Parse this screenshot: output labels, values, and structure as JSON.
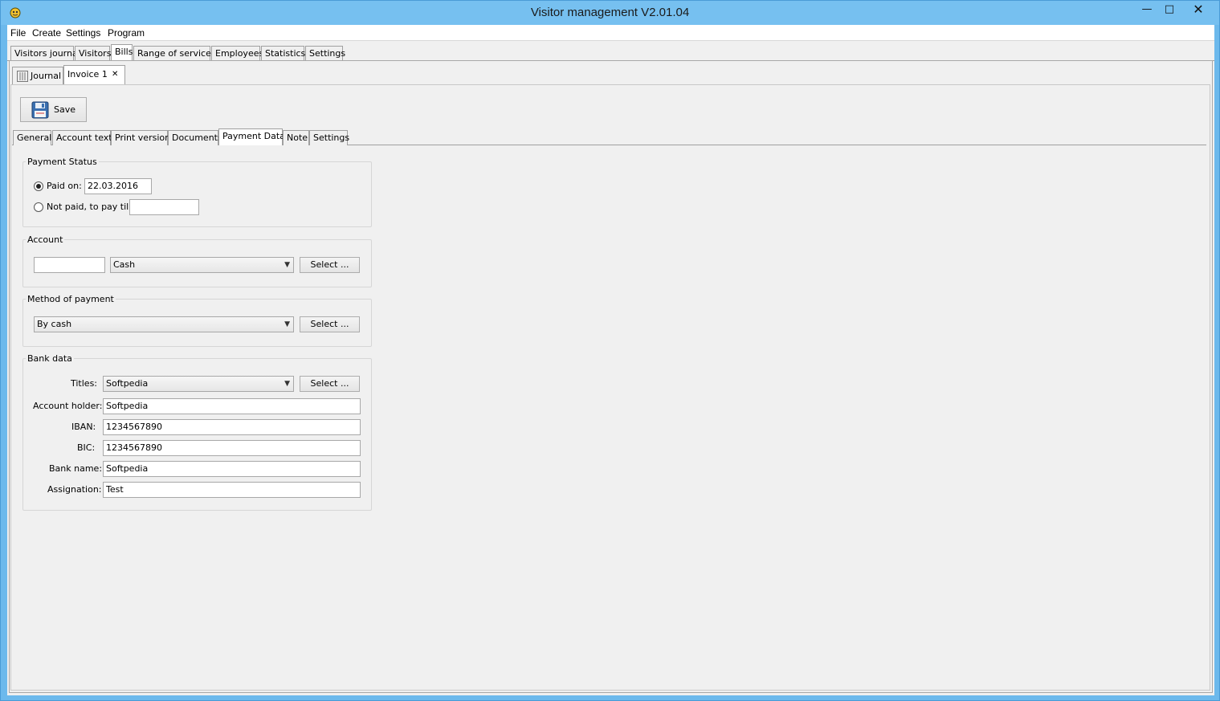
{
  "window": {
    "title": "Visitor management V2.01.04",
    "min_icon": "minimize-icon",
    "max_icon": "maximize-icon",
    "close_icon": "close-icon",
    "min_glyph": "—",
    "max_glyph": "□",
    "close_glyph": "✕"
  },
  "menu": [
    "File",
    "Create",
    "Settings",
    "Program"
  ],
  "main_tabs": [
    "Visitors journal",
    "Visitors",
    "Bills",
    "Range of services",
    "Employees",
    "Statistics",
    "Settings"
  ],
  "main_tab_active": "Bills",
  "doc_tabs": {
    "journal_label": "Journal",
    "invoice_label": "Invoice 1",
    "close_glyph": "✕"
  },
  "toolbar": {
    "save_label": "Save"
  },
  "sub_tabs": [
    "General",
    "Account text",
    "Print version",
    "Documents",
    "Payment Data",
    "Note",
    "Settings"
  ],
  "sub_tab_active": "Payment Data",
  "payment_status": {
    "title": "Payment Status",
    "paid_label": "Paid on:",
    "paid_date": "22.03.2016",
    "not_paid_label": "Not paid, to pay till:",
    "not_paid_date": "",
    "selected": "paid"
  },
  "account": {
    "title": "Account",
    "number": "",
    "selected": "Cash",
    "select_label": "Select ..."
  },
  "method": {
    "title": "Method of payment",
    "selected": "By cash",
    "select_label": "Select ..."
  },
  "bank": {
    "title": "Bank data",
    "titles_label": "Titles:",
    "titles_value": "Softpedia",
    "select_label": "Select ...",
    "holder_label": "Account holder:",
    "holder_value": "Softpedia",
    "iban_label": "IBAN:",
    "iban_value": "1234567890",
    "bic_label": "BIC:",
    "bic_value": "1234567890",
    "bankname_label": "Bank name:",
    "bankname_value": "Softpedia",
    "assignation_label": "Assignation:",
    "assignation_value": "Test"
  },
  "colors": {
    "titlebar": "#76c0f0",
    "panel": "#f0f0f0"
  }
}
